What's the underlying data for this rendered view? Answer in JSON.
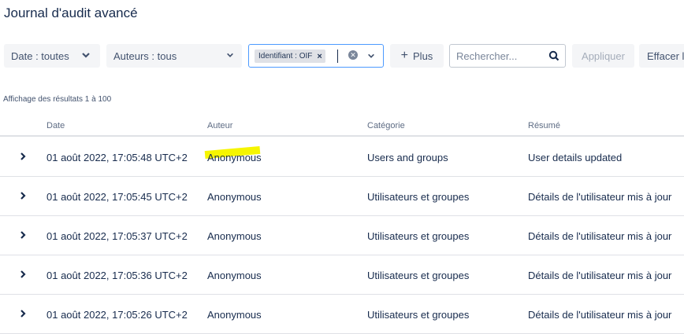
{
  "page": {
    "title": "Journal d'audit avancé"
  },
  "toolbar": {
    "date_filter": "Date : toutes",
    "authors_filter": "Auteurs : tous",
    "id_tag": "Identifiant : OIF",
    "tag_remove": "×",
    "more_label": "Plus",
    "more_icon": "+",
    "search_placeholder": "Rechercher...",
    "apply_label": "Appliquer",
    "clear_label": "Effacer l"
  },
  "results_text": "Affichage des résultats 1 à 100",
  "table": {
    "headers": {
      "date": "Date",
      "author": "Auteur",
      "category": "Catégorie",
      "summary": "Résumé"
    },
    "rows": [
      {
        "date": "01 août 2022, 17:05:48 UTC+2",
        "author": "Anonymous",
        "category": "Users and groups",
        "summary": "User details updated"
      },
      {
        "date": "01 août 2022, 17:05:45 UTC+2",
        "author": "Anonymous",
        "category": "Utilisateurs et groupes",
        "summary": "Détails de l'utilisateur mis à jour"
      },
      {
        "date": "01 août 2022, 17:05:37 UTC+2",
        "author": "Anonymous",
        "category": "Utilisateurs et groupes",
        "summary": "Détails de l'utilisateur mis à jour"
      },
      {
        "date": "01 août 2022, 17:05:36 UTC+2",
        "author": "Anonymous",
        "category": "Utilisateurs et groupes",
        "summary": "Détails de l'utilisateur mis à jour"
      },
      {
        "date": "01 août 2022, 17:05:26 UTC+2",
        "author": "Anonymous",
        "category": "Utilisateurs et groupes",
        "summary": "Détails de l'utilisateur mis à jour"
      }
    ]
  },
  "colors": {
    "text": "#172b4d",
    "focus_border": "#4c9aff",
    "highlight": "#f6f500",
    "button_bg": "#f4f5f7"
  }
}
